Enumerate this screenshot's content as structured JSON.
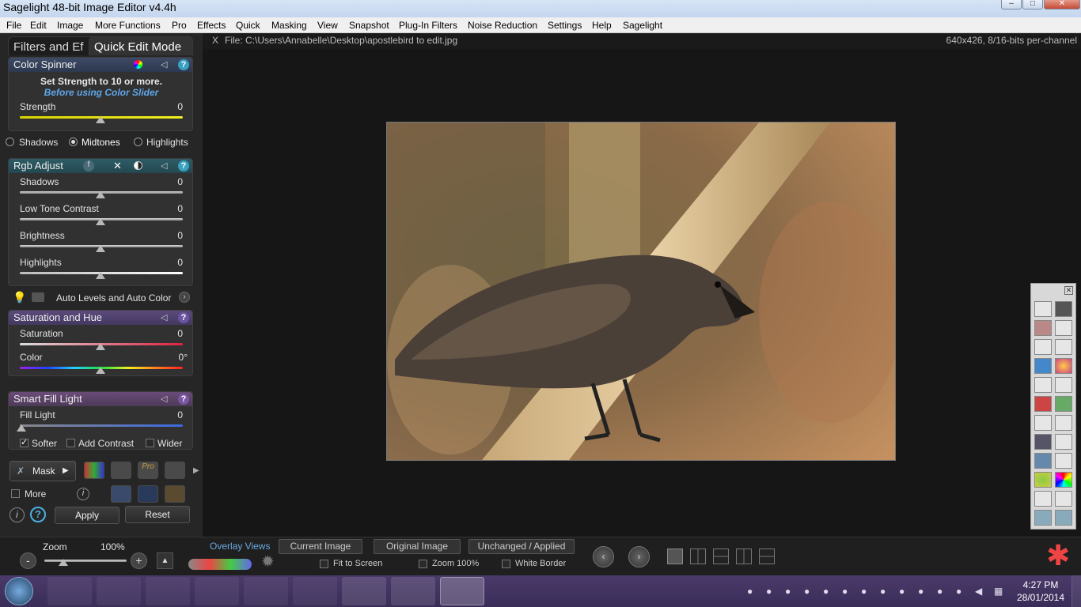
{
  "window": {
    "title": "Sagelight 48-bit Image Editor v4.4h",
    "min": "–",
    "max": "□",
    "close": "✕"
  },
  "menu": [
    "File",
    "Edit",
    "Image",
    "More Functions",
    "Pro",
    "Effects",
    "Quick",
    "Masking",
    "View",
    "Snapshot",
    "Plug-In Filters",
    "Noise Reduction",
    "Settings",
    "Help",
    "Sagelight"
  ],
  "tabs": {
    "filters": "Filters and Ef",
    "quick": "Quick Edit Mode"
  },
  "color_spinner": {
    "title": "Color Spinner",
    "note1": "Set Strength to 10 or more.",
    "note2": "Before using Color Slider",
    "strength_label": "Strength",
    "strength_value": "0",
    "strength_level": 0.5
  },
  "tone_options": {
    "shadows": "Shadows",
    "midtones": "Midtones",
    "highlights": "Highlights",
    "selected": "Midtones"
  },
  "rgb_adjust": {
    "title": "Rgb Adjust",
    "sliders": [
      {
        "label": "Shadows",
        "value": "0",
        "level": 0.5
      },
      {
        "label": "Low Tone Contrast",
        "value": "0",
        "level": 0.5
      },
      {
        "label": "Brightness",
        "value": "0",
        "level": 0.5
      },
      {
        "label": "Highlights",
        "value": "0",
        "level": 0.5
      }
    ]
  },
  "auto_levels": {
    "label": "Auto Levels and Auto Color"
  },
  "saturation_hue": {
    "title": "Saturation and Hue",
    "sat_label": "Saturation",
    "sat_value": "0",
    "color_label": "Color",
    "color_value": "0°"
  },
  "fill_light": {
    "title": "Smart Fill Light",
    "label": "Fill Light",
    "value": "0",
    "softer": "Softer",
    "add_contrast": "Add Contrast",
    "wider": "Wider"
  },
  "actions": {
    "mask": "Mask",
    "more": "More",
    "apply": "Apply",
    "reset": "Reset"
  },
  "file": {
    "path": "File: C:\\Users\\Annabelle\\Desktop\\apostlebird to edit.jpg",
    "info": "640x426, 8/16-bits per-channel",
    "close": "X"
  },
  "bottom": {
    "zoom_label": "Zoom",
    "zoom_value": "100%",
    "zoom_minus": "-",
    "zoom_plus": "+",
    "overlay_label": "Overlay Views",
    "current": "Current Image",
    "original": "Original Image",
    "unchanged": "Unchanged / Applied",
    "fit": "Fit to Screen",
    "zoom100": "Zoom 100%",
    "white_border": "White Border"
  },
  "taskbar": {
    "time": "4:27 PM",
    "date": "28/01/2014"
  },
  "colors": {
    "panel": "#262626",
    "menubar": "#f0f0f0",
    "taskbar": "#3a2d58",
    "accent_blue": "#39a0c0"
  }
}
